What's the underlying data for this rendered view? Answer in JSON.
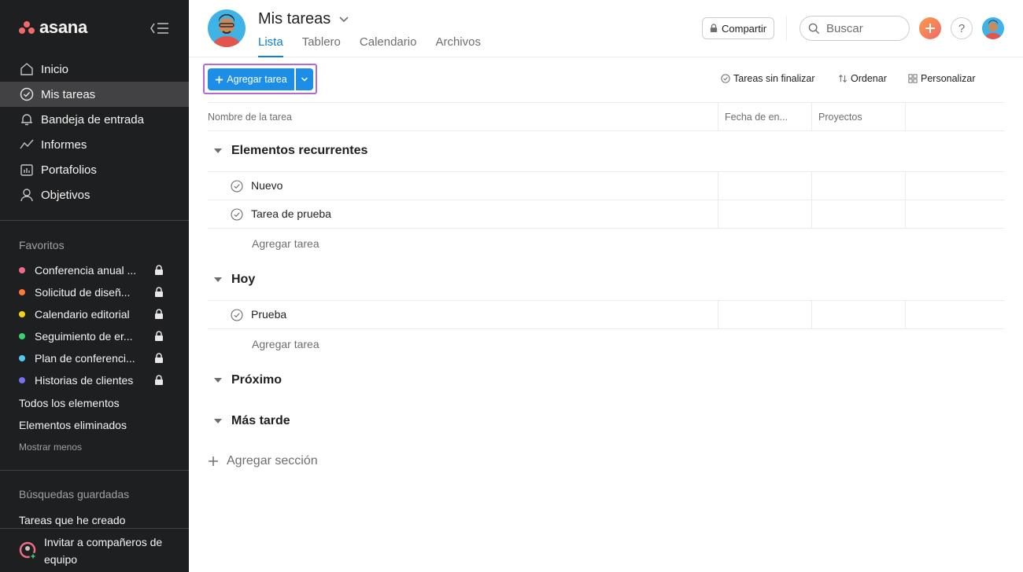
{
  "sidebar": {
    "logo_text": "asana",
    "nav": [
      {
        "label": "Inicio",
        "icon": "home-icon"
      },
      {
        "label": "Mis tareas",
        "icon": "check-circle-icon",
        "active": true
      },
      {
        "label": "Bandeja de entrada",
        "icon": "bell-icon"
      },
      {
        "label": "Informes",
        "icon": "chart-line-icon"
      },
      {
        "label": "Portafolios",
        "icon": "folder-icon"
      },
      {
        "label": "Objetivos",
        "icon": "person-icon"
      }
    ],
    "favorites_title": "Favoritos",
    "favorites": [
      {
        "label": "Conferencia anual ...",
        "color": "#f06a8a"
      },
      {
        "label": "Solicitud de diseñ...",
        "color": "#fd7b33"
      },
      {
        "label": "Calendario editorial",
        "color": "#f8d210"
      },
      {
        "label": "Seguimiento de er...",
        "color": "#3bd16f"
      },
      {
        "label": "Plan de conferenci...",
        "color": "#4ecbf2"
      },
      {
        "label": "Historias de clientes",
        "color": "#7a6ff0"
      }
    ],
    "all_items": "Todos los elementos",
    "deleted_items": "Elementos eliminados",
    "show_less": "Mostrar menos",
    "saved_searches_title": "Búsquedas guardadas",
    "saved_search_item": "Tareas que he creado",
    "invite_label": "Invitar a compañeros de equipo"
  },
  "header": {
    "title": "Mis tareas",
    "tabs": [
      "Lista",
      "Tablero",
      "Calendario",
      "Archivos"
    ],
    "active_tab": "Lista",
    "share_label": "Compartir",
    "search_placeholder": "Buscar",
    "help_label": "?"
  },
  "toolbar": {
    "add_task_label": "Agregar tarea",
    "filter_label": "Tareas sin finalizar",
    "sort_label": "Ordenar",
    "customize_label": "Personalizar"
  },
  "table": {
    "columns": [
      "Nombre de la tarea",
      "Fecha de en...",
      "Proyectos"
    ],
    "sections": [
      {
        "title": "Elementos recurrentes",
        "tasks": [
          "Nuevo",
          "Tarea de prueba"
        ],
        "add_task": "Agregar tarea"
      },
      {
        "title": "Hoy",
        "tasks": [
          "Prueba"
        ],
        "add_task": "Agregar tarea"
      },
      {
        "title": "Próximo",
        "tasks": []
      },
      {
        "title": "Más tarde",
        "tasks": []
      }
    ],
    "add_section_label": "Agregar sección"
  },
  "colors": {
    "sidebar_bg": "#1e1f21",
    "accent_blue": "#1c8ee8",
    "active_tab": "#0d7fd6",
    "highlight_outline": "#b36bd4",
    "logo_coral": "#f06a6a"
  }
}
